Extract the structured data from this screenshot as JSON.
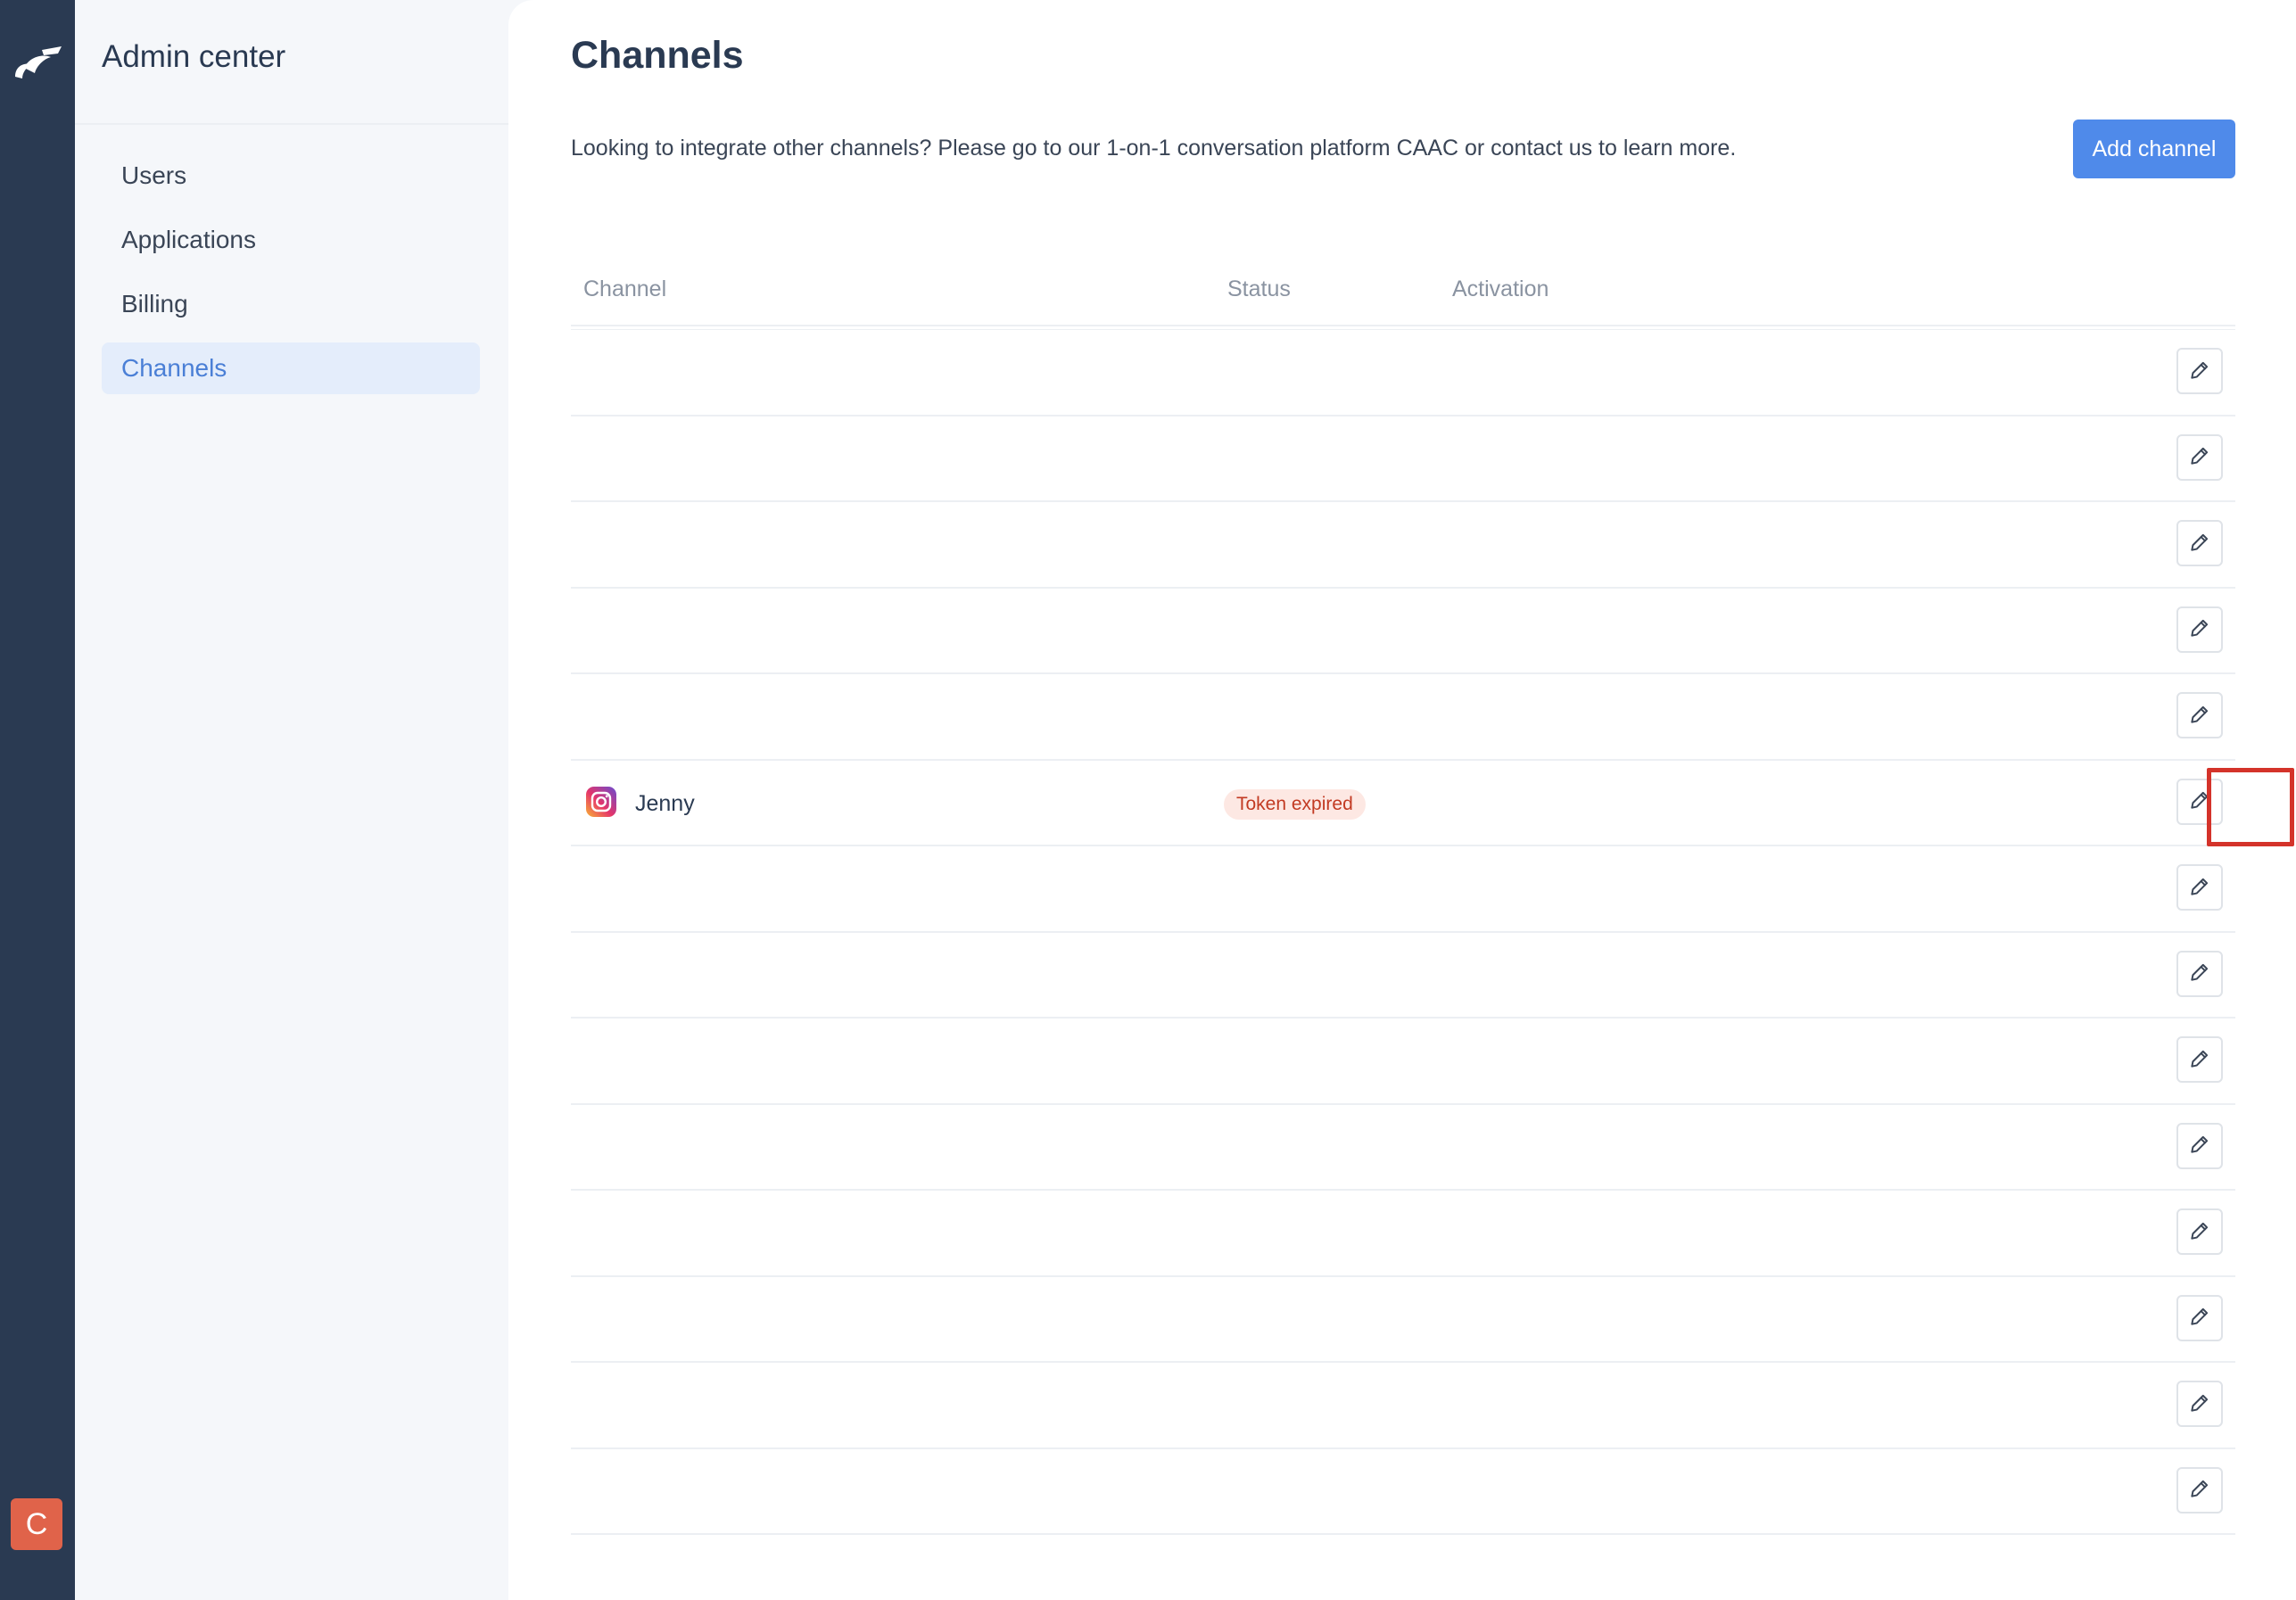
{
  "sidebar": {
    "title": "Admin center",
    "items": [
      {
        "label": "Users"
      },
      {
        "label": "Applications"
      },
      {
        "label": "Billing"
      },
      {
        "label": "Channels",
        "active": true
      }
    ]
  },
  "rail": {
    "avatar_letter": "C",
    "avatar_color": "#e0634a"
  },
  "main": {
    "title": "Channels",
    "info_text": "Looking to integrate other channels? Please go to our 1-on-1 conversation platform CAAC or contact us to learn more.",
    "add_button_label": "Add channel",
    "table": {
      "columns": [
        "Channel",
        "Status",
        "Activation"
      ],
      "rows": [
        {
          "channel": "",
          "status": ""
        },
        {
          "channel": "",
          "status": ""
        },
        {
          "channel": "",
          "status": ""
        },
        {
          "channel": "",
          "status": ""
        },
        {
          "channel": "",
          "status": ""
        },
        {
          "channel": "Jenny",
          "icon": "instagram-icon",
          "status": "Token expired",
          "highlighted": true
        },
        {
          "channel": "",
          "status": ""
        },
        {
          "channel": "",
          "status": ""
        },
        {
          "channel": "",
          "status": ""
        },
        {
          "channel": "",
          "status": ""
        },
        {
          "channel": "",
          "status": ""
        },
        {
          "channel": "",
          "status": ""
        },
        {
          "channel": "",
          "status": ""
        },
        {
          "channel": "",
          "status": ""
        }
      ]
    }
  },
  "colors": {
    "accent": "#4f8aea",
    "rail": "#2a3a52",
    "badge_bg": "#fde8e3",
    "badge_text": "#c23a22",
    "highlight": "#d4332a"
  }
}
